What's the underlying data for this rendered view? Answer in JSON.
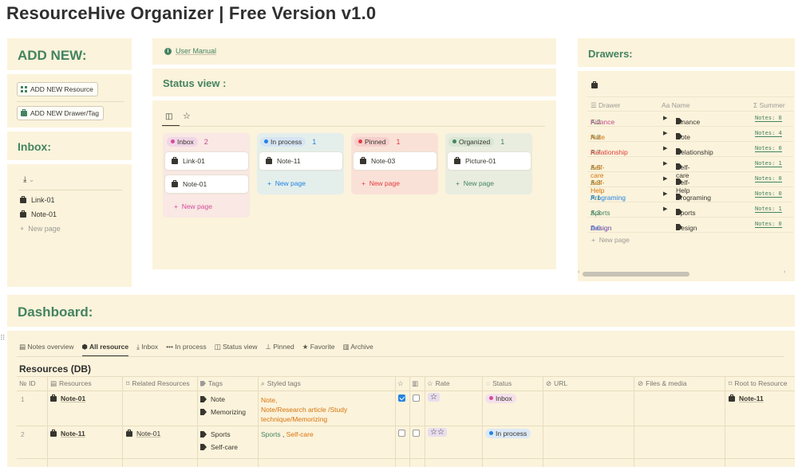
{
  "app": {
    "title": "ResourceHive Organizer | Free Version v1.0"
  },
  "add_new": {
    "heading": "ADD NEW:",
    "resource_button": "ADD NEW Resource",
    "drawer_button": "ADD NEW Drawer/Tag"
  },
  "inbox": {
    "heading": "Inbox:",
    "items": [
      "Link-01",
      "Note-01"
    ],
    "new_page": "New page"
  },
  "manual": {
    "link": "User Manual"
  },
  "status_view": {
    "heading": "Status view :",
    "columns": [
      {
        "name": "Inbox",
        "count": "2",
        "color": "#d44c9e",
        "cards": [
          "Link-01",
          "Note-01"
        ],
        "new_page": "New page"
      },
      {
        "name": "In process",
        "count": "1",
        "color": "#2383e2",
        "cards": [
          "Note-11"
        ],
        "new_page": "New page"
      },
      {
        "name": "Pinned",
        "count": "1",
        "color": "#e03e3e",
        "cards": [
          "Note-03"
        ],
        "new_page": "New page"
      },
      {
        "name": "Organized",
        "count": "1",
        "color": "#448361",
        "cards": [
          "Picture-01"
        ],
        "new_page": "New page"
      }
    ]
  },
  "drawers": {
    "heading": "Drawers:",
    "headers": {
      "drawer": "Drawer",
      "name": "Name",
      "summer": "Summer"
    },
    "rows": [
      {
        "code": "A.2",
        "label": "Finance",
        "name": "Finance",
        "notes": "Notes: 0",
        "color": "#c14c8a",
        "toggle": true
      },
      {
        "code": "A.8",
        "label": "Note",
        "name": "Note",
        "notes": "Notes: 4",
        "color": "#d9730d",
        "toggle": true
      },
      {
        "code": "A.7",
        "label": "Relationship",
        "name": "Relationship",
        "notes": "Notes: 0",
        "color": "#e03e3e",
        "toggle": true
      },
      {
        "code": "A.5",
        "label": "Self-care",
        "name": "Self-care",
        "notes": "Notes: 1",
        "color": "#d9730d",
        "toggle": true
      },
      {
        "code": "A.3",
        "label": "Self-Help",
        "name": "Self-Help",
        "notes": "Notes: 0",
        "color": "#d9730d",
        "toggle": true
      },
      {
        "code": "A.1",
        "label": "Programing",
        "name": "Programing",
        "notes": "Notes: 0",
        "color": "#2383e2",
        "toggle": true
      },
      {
        "code": "A.3",
        "label": "Sports",
        "name": "Sports",
        "notes": "Notes: 1",
        "color": "#448361",
        "toggle": true
      },
      {
        "code": "A.0 ",
        "label": "Design",
        "name": "Design",
        "notes": "Notes: 0",
        "color": "#6940a5",
        "toggle": false
      }
    ],
    "new_page": "New page"
  },
  "dashboard": {
    "heading": "Dashboard:",
    "tabs": [
      "Notes overview",
      "All resource",
      "Inbox",
      "In process",
      "Status view",
      "Pinned",
      "Favorite",
      "Archive"
    ],
    "active_tab": "All resource",
    "db_title": "Resources (DB)",
    "columns": [
      "ID",
      "Resources",
      "Related Resources",
      "Tags",
      "Styled tags",
      "Rate",
      "Status",
      "URL",
      "Files & media",
      "Root to Resource"
    ],
    "id_prefix": "№",
    "rows": [
      {
        "id": "1",
        "resource": "Note-01",
        "related": "",
        "tags": [
          "Note",
          "Memorizing"
        ],
        "styled": [
          "Note,",
          "Note/Research article /Study",
          "technique/Memorizing"
        ],
        "fav": true,
        "archive": false,
        "rate": "☆",
        "status": "Inbox",
        "status_color": "#d44c9e",
        "status_bg": "#f5e0ec",
        "root": "Note-11"
      },
      {
        "id": "2",
        "resource": "Note-11",
        "related": "Note-01",
        "tags": [
          "Sports",
          "Self-care"
        ],
        "styled_a": "Sports",
        "styled_sep": " , ",
        "styled_b": "Self-care",
        "fav": false,
        "archive": false,
        "rate": "☆☆",
        "status": "In process",
        "status_color": "#2383e2",
        "status_bg": "#dde9f7",
        "root": ""
      }
    ]
  }
}
